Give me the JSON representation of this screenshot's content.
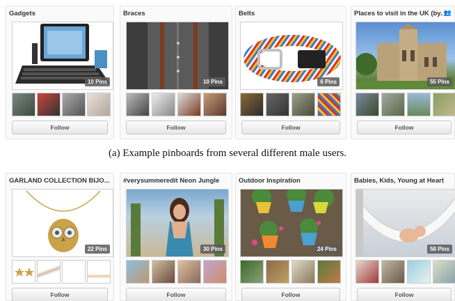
{
  "boards": [
    {
      "title": "Gadgets",
      "pins": "10 Pins",
      "follow": "Follow"
    },
    {
      "title": "Braces",
      "pins": "10 Pins",
      "follow": "Follow"
    },
    {
      "title": "Belts",
      "pins": "6 Pins",
      "follow": "Follow"
    },
    {
      "title": "Places to visit in the UK (by...",
      "pins": "55 Pins",
      "follow": "Follow",
      "shared_icon": "group-icon"
    },
    {
      "title": "GARLAND COLLECTION BIJO...",
      "pins": "22 Pins",
      "follow": "Follow"
    },
    {
      "title": "#verysummeredit Neon Jungle",
      "pins": "30 Pins",
      "follow": "Follow"
    },
    {
      "title": "Outdoor Inspiration",
      "pins": "24 Pins",
      "follow": "Follow"
    },
    {
      "title": "Babies, Kids, Young at Heart",
      "pins": "58 Pins",
      "follow": "Follow"
    }
  ],
  "captions": {
    "male": "(a) Example pinboards from several different male users."
  }
}
